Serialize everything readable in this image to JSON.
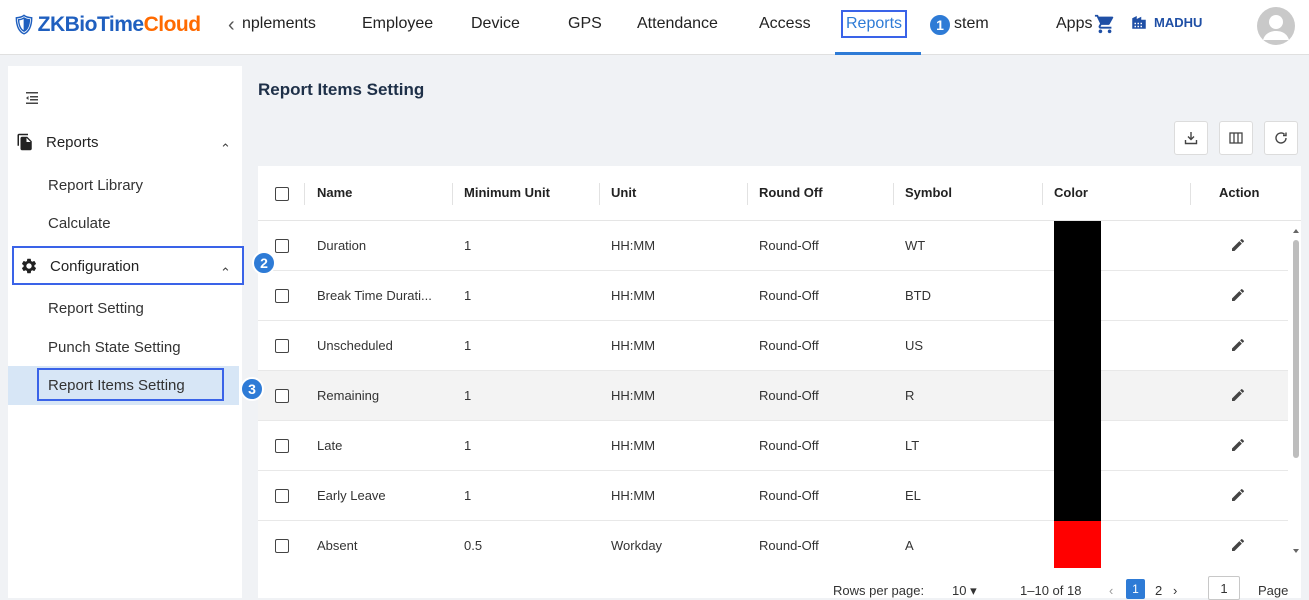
{
  "brand": {
    "shield": "🛡",
    "part1": "ZKBioTime",
    "part2": "Cloud",
    "brand_color": "#1f5fbf",
    "accent_color": "#ff6a00"
  },
  "nav": {
    "prev_arrow": "‹",
    "items": [
      "nplements",
      "Employee",
      "Device",
      "GPS",
      "Attendance",
      "Access",
      "Reports",
      "stem"
    ],
    "active": "Reports",
    "apps": "Apps",
    "cart_icon": "cart-icon",
    "company": "MADHU"
  },
  "annotations": [
    "1",
    "2",
    "3"
  ],
  "sidebar": {
    "groups": [
      {
        "label": "Reports",
        "icon": "file-copy-icon",
        "items": [
          "Report Library",
          "Calculate"
        ]
      },
      {
        "label": "Configuration",
        "icon": "gear-icon",
        "items": [
          "Report Setting",
          "Punch State Setting",
          "Report Items Setting"
        ]
      }
    ],
    "selected": "Report Items Setting",
    "chevron": "⌃"
  },
  "page": {
    "title": "Report Items Setting"
  },
  "table": {
    "columns": [
      "Name",
      "Minimum Unit",
      "Unit",
      "Round Off",
      "Symbol",
      "Color",
      "Action"
    ],
    "rows": [
      {
        "name": "Duration",
        "min_unit": "1",
        "unit": "HH:MM",
        "round_off": "Round-Off",
        "symbol": "WT",
        "color": "#000000"
      },
      {
        "name": "Break Time Durati...",
        "min_unit": "1",
        "unit": "HH:MM",
        "round_off": "Round-Off",
        "symbol": "BTD",
        "color": "#000000"
      },
      {
        "name": "Unscheduled",
        "min_unit": "1",
        "unit": "HH:MM",
        "round_off": "Round-Off",
        "symbol": "US",
        "color": "#000000"
      },
      {
        "name": "Remaining",
        "min_unit": "1",
        "unit": "HH:MM",
        "round_off": "Round-Off",
        "symbol": "R",
        "color": "#000000"
      },
      {
        "name": "Late",
        "min_unit": "1",
        "unit": "HH:MM",
        "round_off": "Round-Off",
        "symbol": "LT",
        "color": "#000000"
      },
      {
        "name": "Early Leave",
        "min_unit": "1",
        "unit": "HH:MM",
        "round_off": "Round-Off",
        "symbol": "EL",
        "color": "#000000"
      },
      {
        "name": "Absent",
        "min_unit": "0.5",
        "unit": "Workday",
        "round_off": "Round-Off",
        "symbol": "A",
        "color": "#ff0000"
      }
    ]
  },
  "pagination": {
    "rows_per_page_label": "Rows per page:",
    "rows_per_page_value": "10",
    "range": "1–10 of 18",
    "current_page": "1",
    "next_page": "2",
    "page_input": "1",
    "page_label": "Page"
  }
}
